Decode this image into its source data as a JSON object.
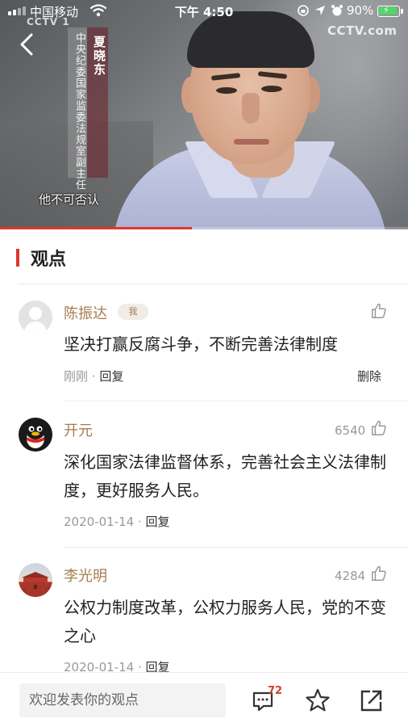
{
  "status_bar": {
    "carrier": "中国移动",
    "time": "下午 4:50",
    "battery": "90%"
  },
  "video": {
    "watermark_left": "CCTV 1",
    "watermark_right": "CCTV.com",
    "caption_title": "中央纪委国家监委法规室副主任",
    "caption_name": "夏晓东",
    "subtitle": "他不可否认",
    "progress": 0.47
  },
  "section": {
    "title": "观点"
  },
  "comments": [
    {
      "user": "陈振达",
      "badge": "我",
      "text": "坚决打赢反腐斗争，不断完善法律制度",
      "time": "刚刚",
      "reply": "回复",
      "delete": "删除",
      "likes": ""
    },
    {
      "user": "开元",
      "text": "深化国家法律监督体系，完善社会主义法律制度，更好服务人民。",
      "time": "2020-01-14",
      "reply": "回复",
      "likes": "6540"
    },
    {
      "user": "李光明",
      "text": "公权力制度改革，公权力服务人民，党的不变之心",
      "time": "2020-01-14",
      "reply": "回复",
      "likes": "4284"
    }
  ],
  "bottom_bar": {
    "input_placeholder": "欢迎发表你的观点",
    "comment_count": "72"
  },
  "icons": {
    "back": "chevron-left-icon",
    "like": "thumbs-up-icon",
    "comment": "comment-bubble-icon",
    "favorite": "star-icon",
    "share": "share-icon"
  },
  "colors": {
    "accent": "#d93a2f",
    "username": "#a67c52",
    "meta": "#999999"
  }
}
